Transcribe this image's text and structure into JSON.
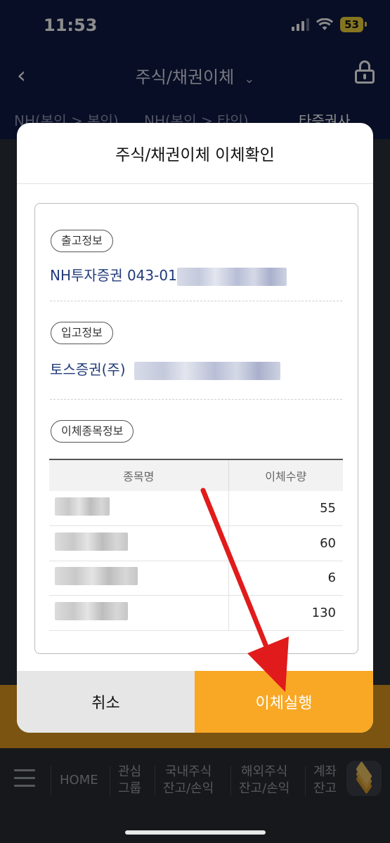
{
  "status_bar": {
    "time": "11:53",
    "battery": "53"
  },
  "header": {
    "title": "주식/채권이체",
    "tabs": [
      "NH(본인 > 본인)",
      "NH(본인 > 타인)",
      "타증권사"
    ]
  },
  "modal": {
    "title": "주식/채권이체 이체확인",
    "outgoing": {
      "label": "출고정보",
      "account": "NH투자증권 043-01"
    },
    "incoming": {
      "label": "입고정보",
      "account": "토스증권(주)"
    },
    "stocks": {
      "label": "이체종목정보",
      "columns": [
        "종목명",
        "이체수량"
      ],
      "rows": [
        {
          "quantity": "55"
        },
        {
          "quantity": "60"
        },
        {
          "quantity": "6"
        },
        {
          "quantity": "130"
        }
      ]
    },
    "cancel_label": "취소",
    "confirm_label": "이체실행"
  },
  "bottom_nav": {
    "home": "HOME",
    "items": [
      {
        "line1": "관심",
        "line2": "그룹"
      },
      {
        "line1": "국내주식",
        "line2": "잔고/손익"
      },
      {
        "line1": "해외주식",
        "line2": "잔고/손익"
      },
      {
        "line1": "계좌",
        "line2": "잔고"
      }
    ]
  },
  "colors": {
    "header_bg": "#0f1a44",
    "confirm_button": "#f9a825",
    "account_text": "#213b7a",
    "annotation_arrow": "#e11b1b"
  }
}
